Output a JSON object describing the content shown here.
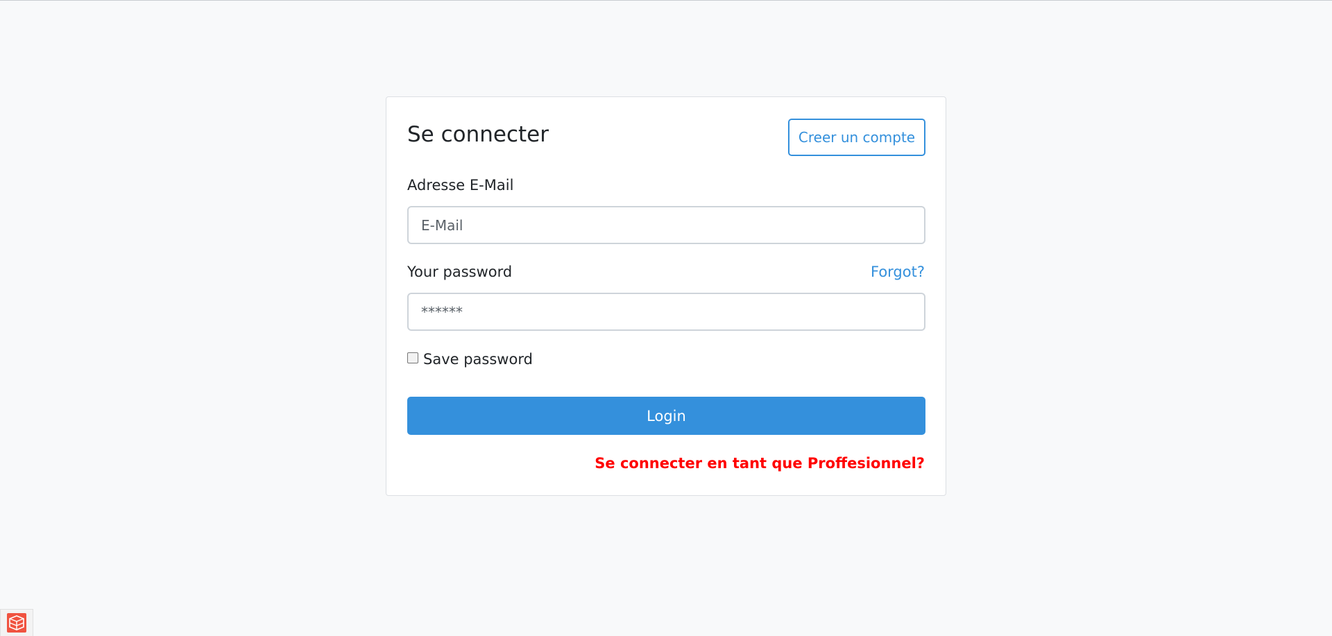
{
  "login_card": {
    "title": "Se connecter",
    "create_account_label": "Creer un compte",
    "email_label": "Adresse E-Mail",
    "email_placeholder": "E-Mail",
    "email_value": "",
    "password_label": "Your password",
    "forgot_label": "Forgot?",
    "password_placeholder": "******",
    "password_value": "",
    "save_password_label": "Save password",
    "save_password_checked": false,
    "login_label": "Login",
    "pro_link_label": "Se connecter en tant que Proffesionnel?"
  },
  "colors": {
    "background": "#f8f9fa",
    "primary": "#3490dc",
    "pro_link": "#ff0000"
  },
  "icons": {
    "corner_logo": "laravel-logo-icon"
  }
}
